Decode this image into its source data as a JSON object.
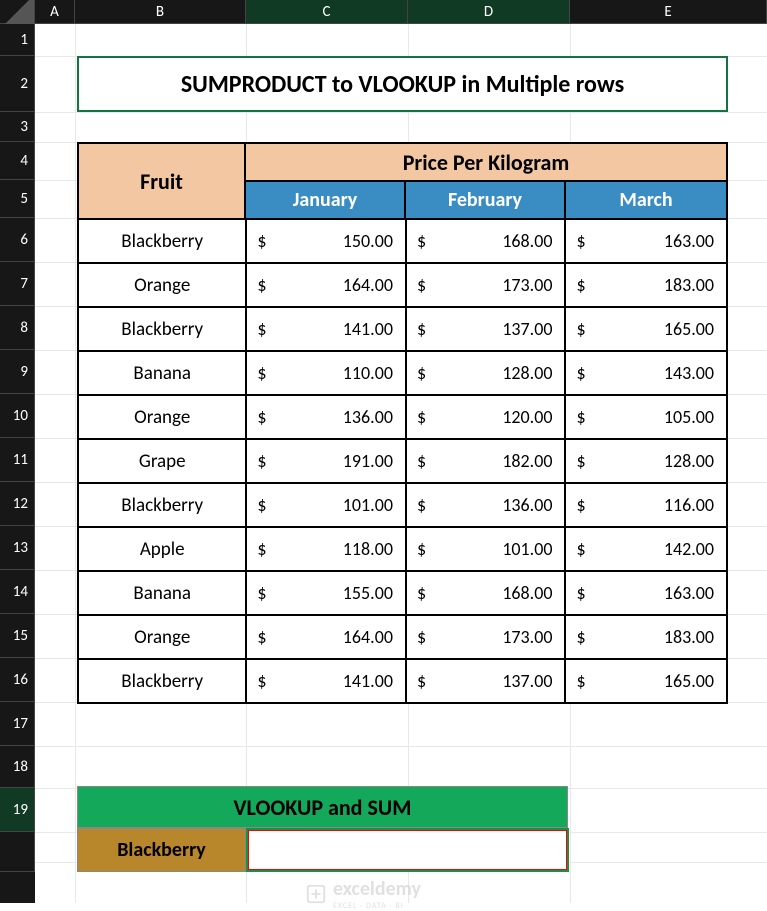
{
  "columns": [
    "A",
    "B",
    "C",
    "D",
    "E"
  ],
  "rows": [
    "1",
    "2",
    "3",
    "4",
    "5",
    "6",
    "7",
    "8",
    "9",
    "10",
    "11",
    "12",
    "13",
    "14",
    "15",
    "16",
    "17",
    "18",
    "19"
  ],
  "title": "SUMPRODUCT to VLOOKUP in Multiple rows",
  "table": {
    "fruit_header": "Fruit",
    "price_header": "Price Per Kilogram",
    "months": [
      "January",
      "February",
      "March"
    ],
    "rows": [
      {
        "fruit": "Blackberry",
        "jan": "150.00",
        "feb": "168.00",
        "mar": "163.00"
      },
      {
        "fruit": "Orange",
        "jan": "164.00",
        "feb": "173.00",
        "mar": "183.00"
      },
      {
        "fruit": "Blackberry",
        "jan": "141.00",
        "feb": "137.00",
        "mar": "165.00"
      },
      {
        "fruit": "Banana",
        "jan": "110.00",
        "feb": "128.00",
        "mar": "143.00"
      },
      {
        "fruit": "Orange",
        "jan": "136.00",
        "feb": "120.00",
        "mar": "105.00"
      },
      {
        "fruit": "Grape",
        "jan": "191.00",
        "feb": "182.00",
        "mar": "128.00"
      },
      {
        "fruit": "Blackberry",
        "jan": "101.00",
        "feb": "136.00",
        "mar": "116.00"
      },
      {
        "fruit": "Apple",
        "jan": "118.00",
        "feb": "101.00",
        "mar": "142.00"
      },
      {
        "fruit": "Banana",
        "jan": "155.00",
        "feb": "168.00",
        "mar": "163.00"
      },
      {
        "fruit": "Orange",
        "jan": "164.00",
        "feb": "173.00",
        "mar": "183.00"
      },
      {
        "fruit": "Blackberry",
        "jan": "141.00",
        "feb": "137.00",
        "mar": "165.00"
      }
    ]
  },
  "lookup": {
    "header": "VLOOKUP and SUM",
    "label": "Blackberry",
    "value": ""
  },
  "currency": "$",
  "watermark": {
    "name": "exceldemy",
    "sub": "EXCEL · DATA · BI"
  },
  "active_row": "19",
  "selected_cols": [
    "C",
    "D"
  ]
}
